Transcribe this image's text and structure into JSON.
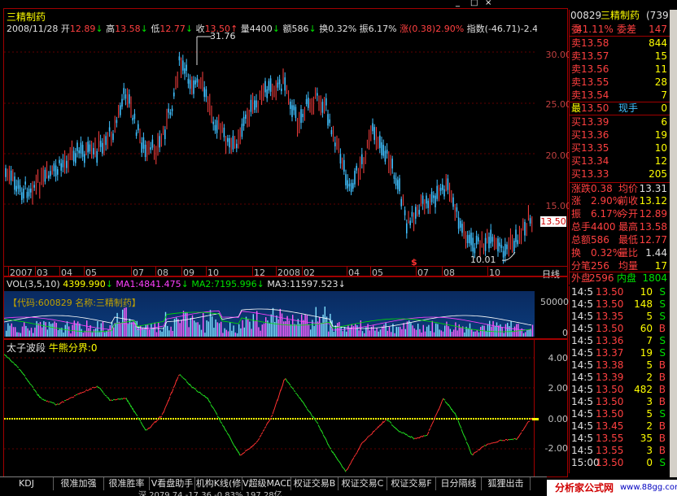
{
  "header": {
    "stock_name": "三精制药",
    "date": "2008/11/28",
    "open_label": "开",
    "open_value": "12.89",
    "high_label": "高",
    "high_value": "13.58",
    "low_label": "低",
    "low_value": "12.77",
    "close_label": "收",
    "close_value": "13.50",
    "vol_label": "量",
    "vol_value": "4400",
    "amt_label": "额",
    "amt_value": "586",
    "turnover_label": "换",
    "turnover_value": "0.32%",
    "amp_label": "振",
    "amp_value": "6.17%",
    "chg_label": "涨",
    "chg_value": "(0.38)",
    "chg_pct": "2.90%",
    "index_label": "指数",
    "index_value": "(-46.71)-2.4"
  },
  "main_chart": {
    "y_ticks": [
      "30.00",
      "25.00",
      "20.00",
      "15.00"
    ],
    "price_tag": "13.50",
    "high_annotation": "31.76",
    "low_annotation": "10.01",
    "x_ticks": [
      "2007",
      "03",
      "04",
      "05",
      "07",
      "08",
      "09",
      "10",
      "12",
      "2008",
      "02",
      "04",
      "05",
      "07",
      "08",
      "10"
    ],
    "period_label": "日线",
    "marker": "$"
  },
  "volume_chart": {
    "title": "VOL(3,5,10)",
    "vol_value": "4399.990",
    "ma1_label": "MA1:",
    "ma1_value": "4841.475",
    "ma2_label": "MA2:",
    "ma2_value": "7195.996",
    "ma3_label": "MA3:",
    "ma3_value": "11597.523",
    "info_text": "【代码:600829 名称:三精制药】",
    "y_ticks": [
      "50000",
      "0"
    ]
  },
  "indicator_chart": {
    "title": "太子波段",
    "line_label": "牛熊分界:",
    "line_value": "0",
    "y_ticks": [
      "4.00",
      "2.00",
      "0.00",
      "-2.00"
    ]
  },
  "quote_panel": {
    "code": "00829",
    "name": "三精制药",
    "code_suffix": "(739",
    "wei_label": "委",
    "wei_value": "41.11%",
    "weicha_label": "委差",
    "weicha_value": "147",
    "sells": [
      {
        "label": "卖",
        "price": "13.58",
        "vol": "844"
      },
      {
        "label": "卖",
        "price": "13.57",
        "vol": "15"
      },
      {
        "label": "卖",
        "price": "13.56",
        "vol": "11"
      },
      {
        "label": "卖",
        "price": "13.55",
        "vol": "28"
      },
      {
        "label": "卖",
        "price": "13.54",
        "vol": "7"
      }
    ],
    "last_label": "最",
    "last_price": "13.50",
    "hand_label": "现手",
    "hand_value": "0",
    "buys": [
      {
        "label": "买",
        "price": "13.39",
        "vol": "6"
      },
      {
        "label": "买",
        "price": "13.36",
        "vol": "19"
      },
      {
        "label": "买",
        "price": "13.35",
        "vol": "10"
      },
      {
        "label": "买",
        "price": "13.34",
        "vol": "12"
      },
      {
        "label": "买",
        "price": "13.33",
        "vol": "205"
      }
    ],
    "stats": [
      {
        "l1": "涨跌",
        "v1": "0.38",
        "l2": "均价",
        "v2": "13.31"
      },
      {
        "l1": "涨",
        "v1": "2.90%",
        "l2": "前收",
        "v2": "13.12"
      },
      {
        "l1": "振",
        "v1": "6.17%",
        "l2": "今开",
        "v2": "12.89"
      },
      {
        "l1": "总手",
        "v1": "4400",
        "l2": "最高",
        "v2": "13.58"
      },
      {
        "l1": "总额",
        "v1": "586",
        "l2": "最低",
        "v2": "12.77"
      },
      {
        "l1": "换",
        "v1": "0.32%",
        "l2": "量比",
        "v2": "1.44"
      },
      {
        "l1": "分笔",
        "v1": "256",
        "l2": "均量",
        "v2": "17"
      }
    ],
    "outer_label": "外盘",
    "outer_value": "2596",
    "inner_label": "内盘",
    "inner_value": "1804"
  },
  "trades": [
    {
      "time": "14:5",
      "price": "13.50",
      "vol": "10",
      "dir": "S"
    },
    {
      "time": "14:5",
      "price": "13.50",
      "vol": "148",
      "dir": "S"
    },
    {
      "time": "14:5",
      "price": "13.35",
      "vol": "5",
      "dir": "S"
    },
    {
      "time": "14:5",
      "price": "13.50",
      "vol": "60",
      "dir": "B"
    },
    {
      "time": "14:5",
      "price": "13.36",
      "vol": "7",
      "dir": "S"
    },
    {
      "time": "14:5",
      "price": "13.37",
      "vol": "19",
      "dir": "S"
    },
    {
      "time": "14:5",
      "price": "13.38",
      "vol": "5",
      "dir": "B"
    },
    {
      "time": "14:5",
      "price": "13.39",
      "vol": "2",
      "dir": "B"
    },
    {
      "time": "14:5",
      "price": "13.50",
      "vol": "482",
      "dir": "B"
    },
    {
      "time": "14:5",
      "price": "13.50",
      "vol": "3",
      "dir": "B"
    },
    {
      "time": "14:5",
      "price": "13.50",
      "vol": "5",
      "dir": "S"
    },
    {
      "time": "14:5",
      "price": "13.45",
      "vol": "2",
      "dir": "B"
    },
    {
      "time": "14:5",
      "price": "13.55",
      "vol": "35",
      "dir": "B"
    },
    {
      "time": "14:5",
      "price": "13.55",
      "vol": "3",
      "dir": "B"
    },
    {
      "time": "15:00",
      "price": "13.50",
      "vol": "0",
      "dir": "S"
    }
  ],
  "tabs": [
    "KDJ",
    "很准加强",
    "很准胜率",
    "V看盘助手",
    "机构K线(修",
    "V超级MACD",
    "权证交易B",
    "权证交易C",
    "权证交易F",
    "日分隔线",
    "狐狸出击"
  ],
  "watermark": "分析家公式网",
  "watermark_url": "www.88gg.com",
  "bottom_partial": "深 2079.74 -17.36 -0.83% 197.28亿",
  "window_buttons": [
    "_",
    "□",
    "×"
  ]
}
